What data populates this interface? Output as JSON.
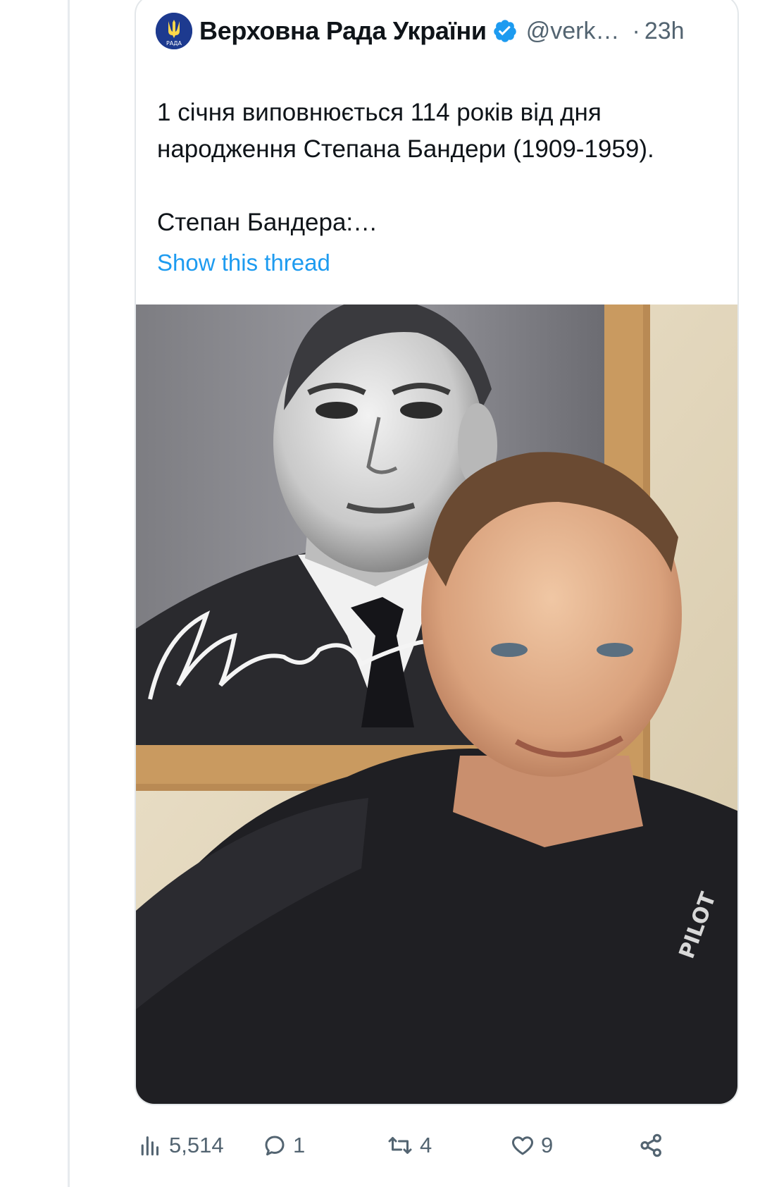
{
  "tweet": {
    "author_name": "Верховна Рада України",
    "handle": "@verk…",
    "separator": "·",
    "time": "23h",
    "avatar_text": "РАДА",
    "text_line1": "1 січня виповнюється 114 років від дня народження Степана Бандери (1909-1959).",
    "text_line2": "Степан Бандера:…",
    "show_thread": "Show this thread",
    "colors": {
      "link": "#1d9bf0",
      "verified": "#1d9bf0",
      "secondary": "#536471",
      "primary": "#0f1419"
    }
  },
  "media": {
    "kind": "photo",
    "signature_text": "Степан Бандера"
  },
  "actions": {
    "views": {
      "icon": "views-icon",
      "count": "5,514"
    },
    "replies": {
      "icon": "reply-icon",
      "count": "1"
    },
    "retweets": {
      "icon": "retweet-icon",
      "count": "4"
    },
    "likes": {
      "icon": "heart-icon",
      "count": "9"
    },
    "share": {
      "icon": "share-icon"
    }
  }
}
